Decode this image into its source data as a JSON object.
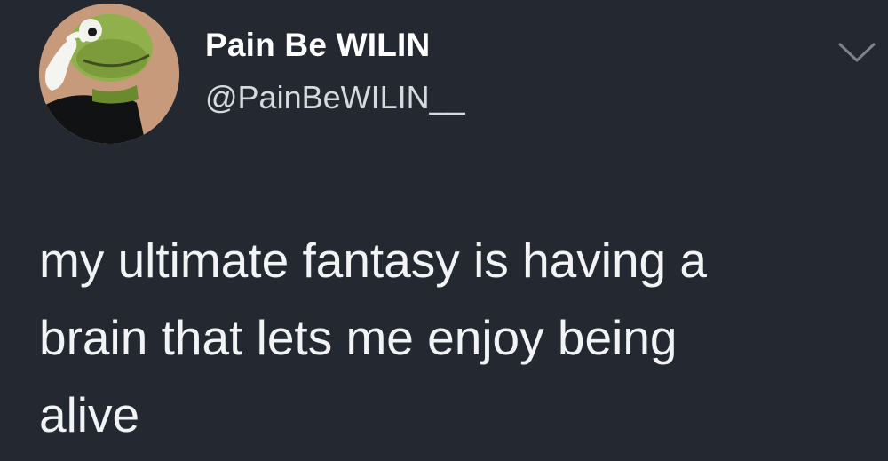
{
  "tweet": {
    "author": {
      "display_name": "Pain Be WILIN",
      "handle": "@PainBeWILIN__",
      "avatar_icon": "kermit-avatar"
    },
    "menu_icon": "chevron-down-icon",
    "text": "my ultimate fantasy is having a\nbrain that lets me enjoy being\nalive"
  },
  "colors": {
    "background": "#242831",
    "text": "#ffffff",
    "handle": "#d6d9de",
    "chevron": "#7b8290"
  }
}
